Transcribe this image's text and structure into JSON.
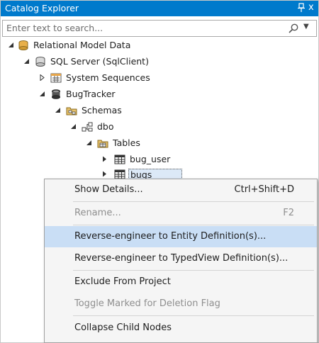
{
  "panel": {
    "title": "Catalog Explorer",
    "pin_icon": "pin-icon",
    "close_glyph": "x"
  },
  "search": {
    "placeholder": "Enter text to search..."
  },
  "tree": {
    "relational_model_data": "Relational Model Data",
    "sql_server": "SQL Server (SqlClient)",
    "system_sequences": "System Sequences",
    "bugtracker": "BugTracker",
    "schemas": "Schemas",
    "dbo": "dbo",
    "tables": "Tables",
    "bug_user": "bug_user",
    "bugs": "bugs"
  },
  "context_menu": {
    "show_details": "Show Details...",
    "show_details_shortcut": "Ctrl+Shift+D",
    "rename": "Rename...",
    "rename_shortcut": "F2",
    "reverse_entity": "Reverse-engineer to Entity Definition(s)...",
    "reverse_typedview": "Reverse-engineer to TypedView Definition(s)...",
    "exclude": "Exclude From Project",
    "toggle_deletion": "Toggle Marked for Deletion Flag",
    "collapse": "Collapse Child Nodes"
  },
  "colors": {
    "title_bar": "#007acc",
    "highlight": "#c9def5"
  }
}
